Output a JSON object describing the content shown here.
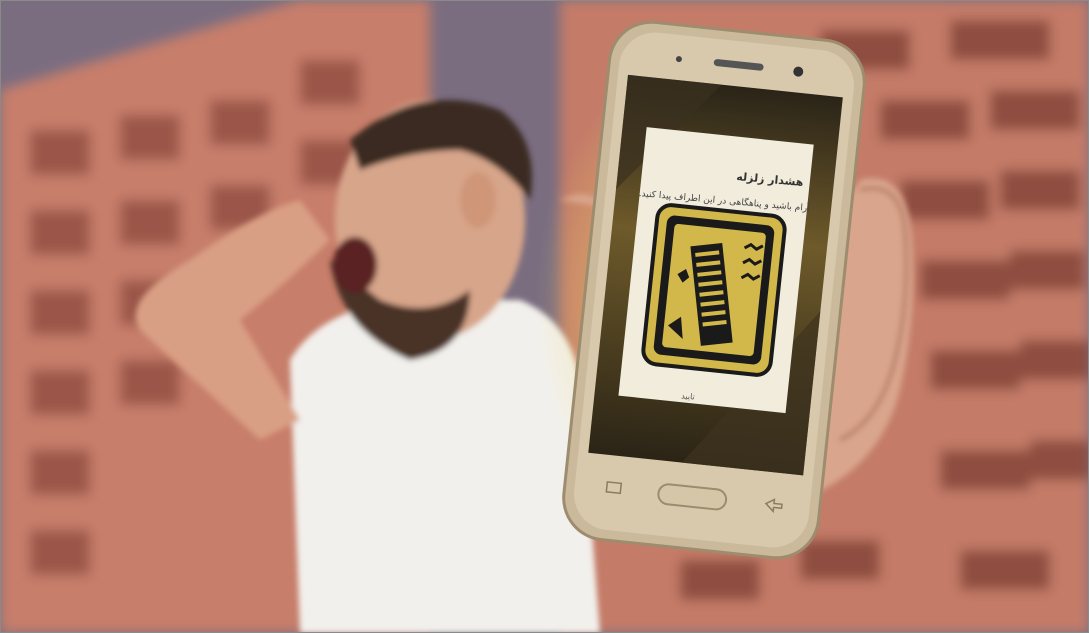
{
  "alert": {
    "title": "هشدار زلزله",
    "message": "آرام باشید و پناهگاهی در این اطراف پیدا کنید.",
    "confirm_label": "تایید",
    "icon": "earthquake-building-icon"
  },
  "colors": {
    "building": "#c9826f",
    "sky": "#6d6478",
    "phone_body": "#c8b89a",
    "alert_icon_bg": "#d2b84a",
    "screen_glow": "#f3e27a",
    "shirt": "#f4f2ee"
  }
}
